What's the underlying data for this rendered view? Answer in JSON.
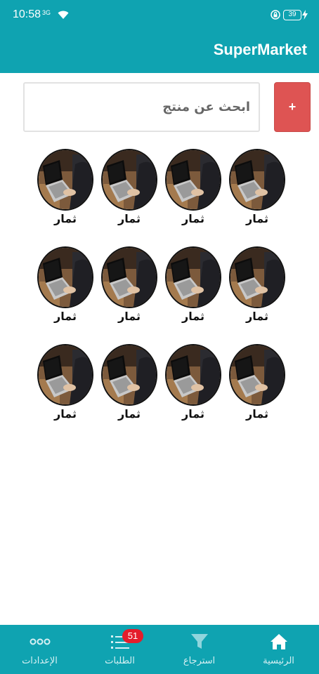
{
  "status_bar": {
    "time": "10:58",
    "network": "3G",
    "battery": "39"
  },
  "app_bar": {
    "title": "SuperMarket"
  },
  "search": {
    "placeholder": "ابحث عن منتج",
    "add_label": "+"
  },
  "products": [
    {
      "name": "ثمار",
      "image": "laptop-user-photo"
    },
    {
      "name": "ثمار",
      "image": "laptop-user-photo"
    },
    {
      "name": "ثمار",
      "image": "laptop-user-photo"
    },
    {
      "name": "ثمار",
      "image": "laptop-user-photo"
    },
    {
      "name": "ثمار",
      "image": "laptop-user-photo"
    },
    {
      "name": "ثمار",
      "image": "laptop-user-photo"
    },
    {
      "name": "ثمار",
      "image": "laptop-user-photo"
    },
    {
      "name": "ثمار",
      "image": "laptop-user-photo"
    },
    {
      "name": "ثمار",
      "image": "laptop-user-photo"
    },
    {
      "name": "ثمار",
      "image": "laptop-user-photo"
    },
    {
      "name": "ثمار",
      "image": "laptop-user-photo"
    },
    {
      "name": "ثمار",
      "image": "laptop-user-photo"
    }
  ],
  "bottom_nav": {
    "items": [
      {
        "label": "الرئيسية",
        "icon": "home-icon",
        "active": true
      },
      {
        "label": "استرجاع",
        "icon": "filter-icon",
        "active": false
      },
      {
        "label": "الطلبات",
        "icon": "orders-list-icon",
        "active": false,
        "badge": "51"
      },
      {
        "label": "الإعدادات",
        "icon": "more-dots-icon",
        "active": false
      }
    ]
  },
  "colors": {
    "primary": "#0fa3b1",
    "add_button": "#de5453",
    "badge": "#e41d2b"
  }
}
